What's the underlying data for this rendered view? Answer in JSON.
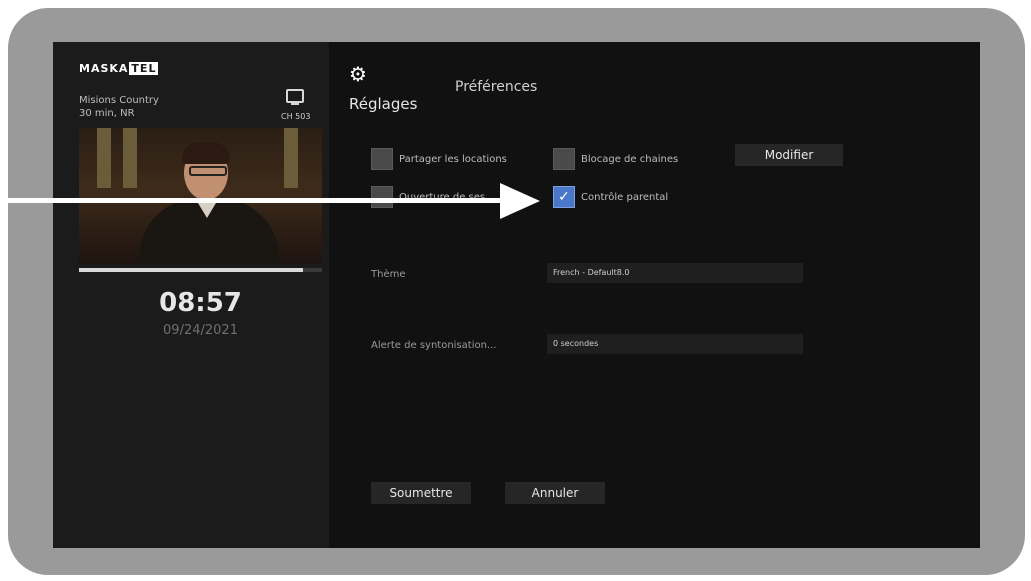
{
  "brand": {
    "logo_left": "MASKA",
    "logo_box": "TEL"
  },
  "now_playing": {
    "title": "Misions Country",
    "meta": "30 min, NR",
    "channel": "CH 503",
    "progress": 0.92
  },
  "clock": {
    "time": "08:57",
    "date": "09/24/2021"
  },
  "header": {
    "settings": "Réglages",
    "preferences": "Préférences"
  },
  "preferences": {
    "share_rentals": {
      "label": "Partager les locations",
      "checked": false
    },
    "channel_blocking": {
      "label": "Blocage de chaines",
      "checked": false
    },
    "hidden_option": {
      "label": "Ouverture de ses",
      "checked": false
    },
    "parental_control": {
      "label": "Contrôle parental",
      "checked": true,
      "check_glyph": "✓"
    },
    "modify_button": "Modifier"
  },
  "theme": {
    "label": "Thème",
    "value": "French - Default8.0"
  },
  "tuning_alert": {
    "label": "Alerte de syntonisation...",
    "value": "0 secondes"
  },
  "actions": {
    "submit": "Soumettre",
    "cancel": "Annuler"
  },
  "colors": {
    "accent_checkbox": "#4a78c8",
    "frame": "#9a9a9a",
    "screen": "#111111"
  }
}
